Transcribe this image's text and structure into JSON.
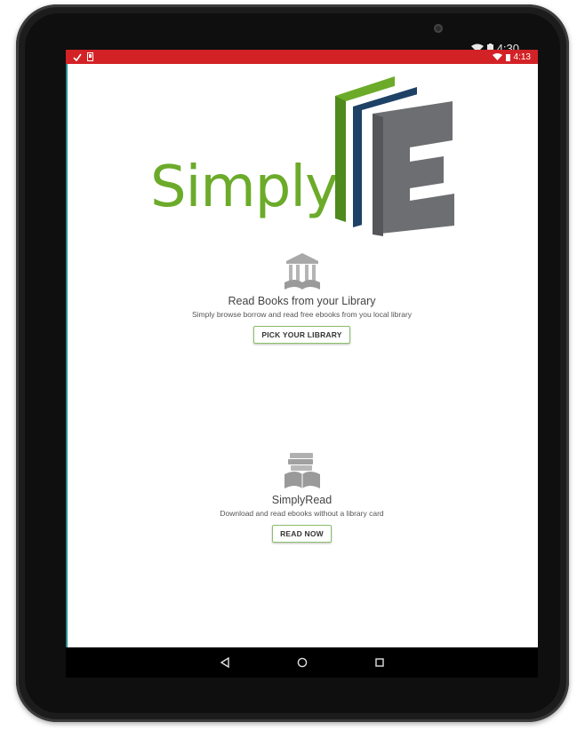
{
  "device": {
    "outer_status": {
      "time": "4:30"
    }
  },
  "status_bar": {
    "time": "4:13",
    "color": "#d32226"
  },
  "logo": {
    "wordmark": "Simply",
    "letter": "E",
    "colors": {
      "green": "#6cab2a",
      "navy": "#1e4166",
      "gray": "#6d6e71"
    }
  },
  "library_section": {
    "icon": "library-building-icon",
    "title": "Read Books from your Library",
    "subtitle": "Simply browse borrow and read free ebooks from you local library",
    "button_label": "PICK YOUR LIBRARY"
  },
  "simplyread_section": {
    "icon": "books-stack-icon",
    "title": "SimplyRead",
    "subtitle": "Download and read ebooks without a library card",
    "button_label": "READ NOW"
  },
  "nav_bar": {
    "items": [
      "back-icon",
      "home-icon",
      "recents-icon"
    ]
  }
}
